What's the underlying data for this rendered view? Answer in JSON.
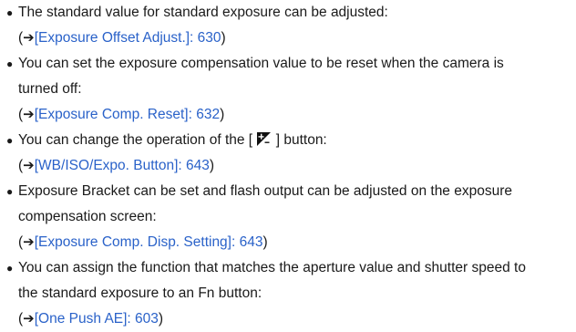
{
  "items": [
    {
      "lines": [
        "The standard value for standard exposure can be adjusted:"
      ],
      "ref_open": "(",
      "ref_arrow": "➔",
      "ref_link": "[Exposure Offset Adjust.]: 630",
      "ref_close": ")"
    },
    {
      "lines": [
        "You can set the exposure compensation value to be reset when the camera is",
        "turned off:"
      ],
      "ref_open": "(",
      "ref_arrow": "➔",
      "ref_link": "[Exposure Comp. Reset]: 632",
      "ref_close": ")"
    },
    {
      "line_before_icon": "You can change the operation of the [ ",
      "icon": "exposure-compensation-icon",
      "line_after_icon": " ] button:",
      "ref_open": "(",
      "ref_arrow": "➔",
      "ref_link": "[WB/ISO/Expo. Button]: 643",
      "ref_close": ")"
    },
    {
      "lines": [
        "Exposure Bracket can be set and flash output can be adjusted on the exposure",
        "compensation screen:"
      ],
      "ref_open": "(",
      "ref_arrow": "➔",
      "ref_link": "[Exposure Comp. Disp. Setting]: 643",
      "ref_close": ")"
    },
    {
      "lines": [
        "You can assign the function that matches the aperture value and shutter speed to",
        "the standard exposure to an Fn button:"
      ],
      "ref_open": "(",
      "ref_arrow": "➔",
      "ref_link": "[One Push AE]: 603",
      "ref_close": ")"
    }
  ],
  "bullet_char": "●"
}
